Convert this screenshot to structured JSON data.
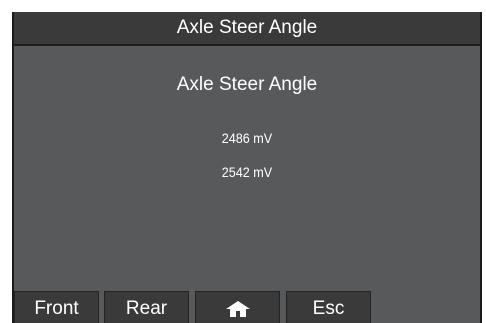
{
  "header": {
    "title": "Axle Steer Angle"
  },
  "main": {
    "heading": "Axle Steer Angle",
    "readings": [
      "2486 mV",
      "2542 mV"
    ]
  },
  "softkeys": [
    {
      "label": "Front",
      "icon": null
    },
    {
      "label": "Rear",
      "icon": null
    },
    {
      "label": "",
      "icon": "home-icon"
    },
    {
      "label": "Esc",
      "icon": null
    }
  ],
  "colors": {
    "screen_background": "#58595b",
    "bar_background": "#3a3a3a",
    "text": "#ffffff"
  }
}
